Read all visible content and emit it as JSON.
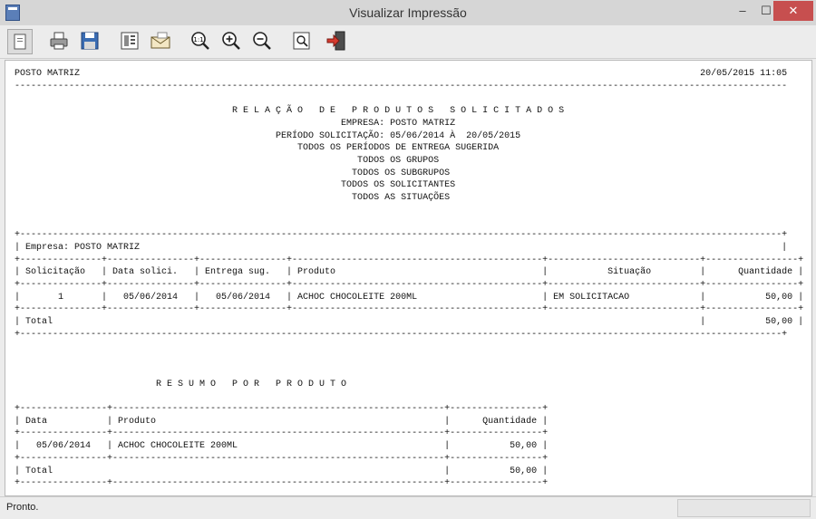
{
  "window": {
    "title": "Visualizar Impressão",
    "controls": {
      "minimize": "–",
      "maximize": "☐",
      "close": "✕"
    }
  },
  "toolbar": {
    "buttons": [
      {
        "name": "page-view",
        "icon": "page-icon"
      },
      {
        "name": "print",
        "icon": "printer-icon"
      },
      {
        "name": "save",
        "icon": "save-icon"
      },
      {
        "name": "setup",
        "icon": "setup-icon"
      },
      {
        "name": "mail",
        "icon": "mail-icon"
      },
      {
        "name": "zoom-actual",
        "icon": "zoom-1to1-icon"
      },
      {
        "name": "zoom-in",
        "icon": "zoom-in-icon"
      },
      {
        "name": "zoom-out",
        "icon": "zoom-out-icon"
      },
      {
        "name": "find",
        "icon": "find-icon"
      },
      {
        "name": "exit",
        "icon": "exit-icon"
      }
    ]
  },
  "report": {
    "left_header": "POSTO MATRIZ",
    "right_header": "20/05/2015 11:05",
    "title": "R E L A Ç Ã O   D E   P R O D U T O S   S O L I C I T A D O S",
    "filters": [
      "EMPRESA: POSTO MATRIZ",
      "PERÍODO SOLICITAÇÃO: 05/06/2014 À  20/05/2015",
      "TODOS OS PERÍODOS DE ENTREGA SUGERIDA",
      "TODOS OS GRUPOS",
      "TODOS OS SUBGRUPOS",
      "TODOS OS SOLICITANTES",
      "TODOS AS SITUAÇÕES"
    ],
    "empresa_line": "Empresa: POSTO MATRIZ",
    "table1": {
      "headers": [
        "Solicitação",
        "Data solici.",
        "Entrega sug.",
        "Produto",
        "Situação",
        "Quantidade"
      ],
      "rows": [
        {
          "sol": "1",
          "data": "05/06/2014",
          "entrega": "05/06/2014",
          "produto": "ACHOC CHOCOLEITE 200ML",
          "situacao": "EM SOLICITACAO",
          "qtd": "50,00"
        }
      ],
      "total_label": "Total",
      "total_value": "50,00"
    },
    "summary_title": "R E S U M O   P O R   P R O D U T O",
    "table2": {
      "headers": [
        "Data",
        "Produto",
        "Quantidade"
      ],
      "rows": [
        {
          "data": "05/06/2014",
          "produto": "ACHOC CHOCOLEITE 200ML",
          "qtd": "50,00"
        }
      ],
      "total_label": "Total",
      "total_value": "50,00"
    }
  },
  "status": {
    "text": "Pronto."
  }
}
